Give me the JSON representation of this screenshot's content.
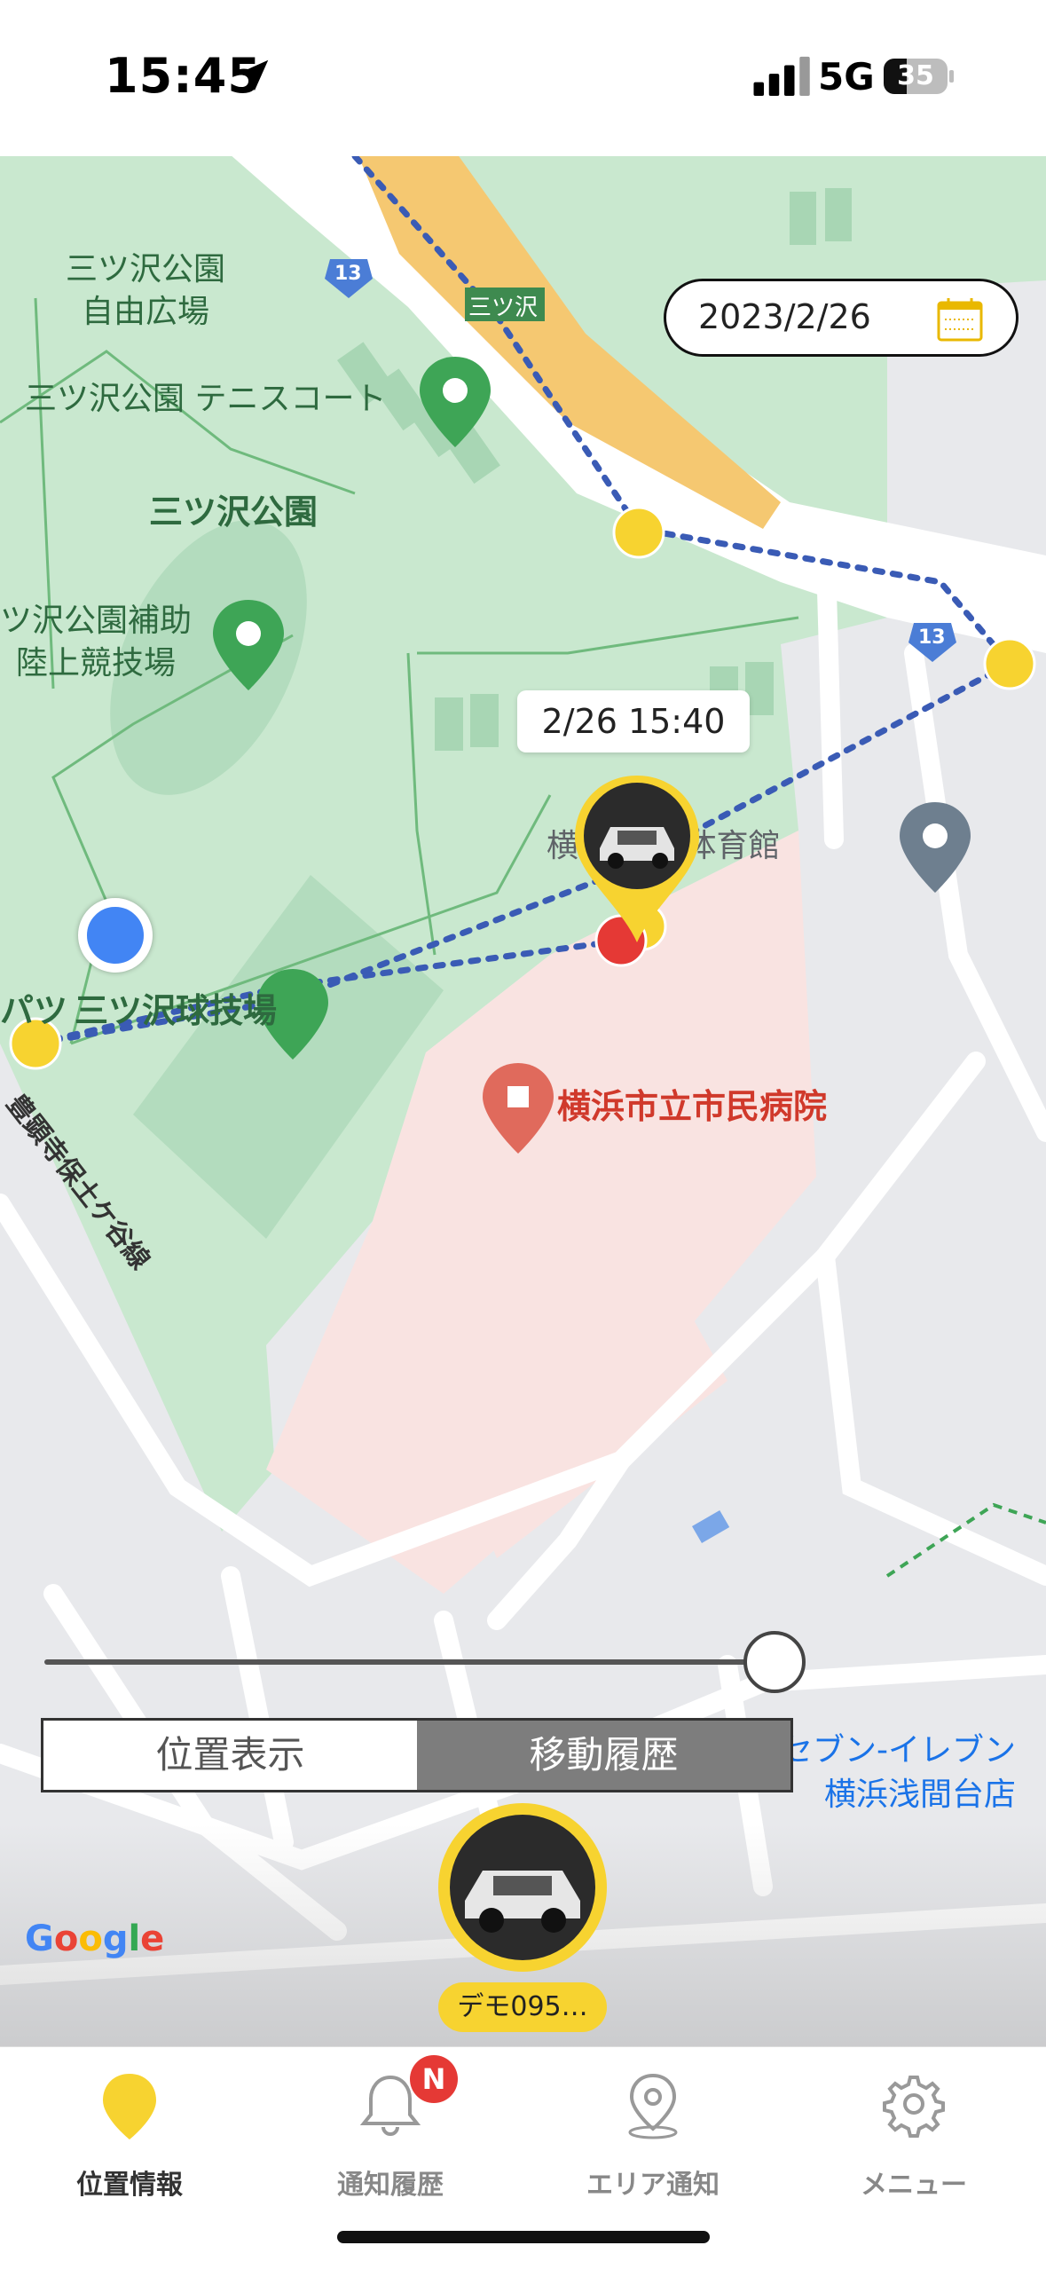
{
  "status_bar": {
    "time": "15:45",
    "network": "5G",
    "battery": "35"
  },
  "map": {
    "labels": {
      "plaza": "三ツ沢公園\n自由広場",
      "tennis": "三ツ沢公園 テニスコート",
      "park": "三ツ沢公園",
      "athletics": "ツ沢公園補助\n陸上競技場",
      "gym": "横浜  記念体育館",
      "ballpark": "三ツ沢球技場",
      "ballpark_prefix": "パツ",
      "hospital": "横浜市立市民病院",
      "road": "豊顕寺保土ケ谷線",
      "station": "三ツ沢",
      "store": "セブン-イレブン\n横浜浅間台店",
      "route_number": "13"
    },
    "date": "2023/2/26",
    "tooltip_time": "2/26 15:40",
    "google": "Google"
  },
  "segment": {
    "position_label": "位置表示",
    "history_label": "移動履歴",
    "selected": "移動履歴"
  },
  "vehicle": {
    "name": "デモ095…"
  },
  "tabs": [
    {
      "label": "位置情報",
      "icon": "location-pin-icon",
      "active": true
    },
    {
      "label": "通知履歴",
      "icon": "bell-icon",
      "badge": "N"
    },
    {
      "label": "エリア通知",
      "icon": "area-pin-icon"
    },
    {
      "label": "メニュー",
      "icon": "gear-icon"
    }
  ],
  "colors": {
    "accent_yellow": "#f7d330",
    "route_blue": "#3a5bb5",
    "park_green": "#c9e8cf",
    "hospital_pink": "#f9e3e1"
  }
}
